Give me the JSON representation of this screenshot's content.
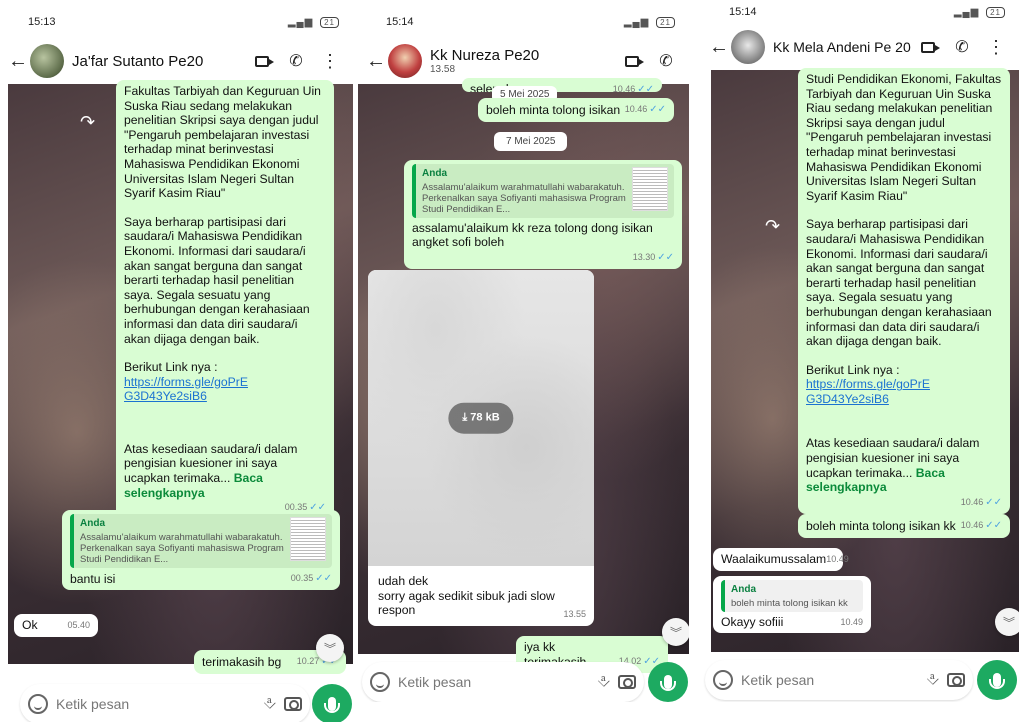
{
  "panels": [
    {
      "time": "15:13",
      "title": "Ja'far Sutanto Pe20",
      "forwarded_text_1": "Fakultas Tarbiyah dan Keguruan Uin Suska Riau sedang melakukan penelitian Skripsi saya dengan judul \"Pengaruh pembelajaran investasi terhadap minat berinvestasi Mahasiswa Pendidikan Ekonomi Universitas Islam Negeri Sultan Syarif Kasim Riau\"",
      "forwarded_text_2": "Saya berharap partisipasi dari saudara/i Mahasiswa Pendidikan Ekonomi. Informasi dari saudara/i akan sangat berguna dan sangat berarti terhadap hasil penelitian saya. Segala sesuatu yang berhubungan dengan kerahasiaan informasi dan data diri saudara/i akan dijaga dengan baik.",
      "link_prefix": "Berikut Link nya :",
      "link": "https://forms.gle/goPrEG3D43Ye2siB6",
      "closing": "Atas kesediaan saudara/i dalam pengisian kuesioner ini saya ucapkan terimaka...",
      "read_more": "Baca selengkapnya",
      "forward_time": "00.35",
      "quote_name": "Anda",
      "quote_body": "Assalamu'alaikum warahmatullahi wabarakatuh. Perkenalkan saya Sofiyanti mahasiswa Program Studi Pendidikan E...",
      "reply_text": "bantu isi",
      "reply_time": "00.35",
      "in_msg": "Ok",
      "in_time": "05.40",
      "out_msg": "terimakasih bg",
      "out_time": "10.27",
      "composer_placeholder": "Ketik pesan"
    },
    {
      "time": "15:14",
      "title": "Kk Nureza Pe20",
      "subtitle": "13.58",
      "top_partial": "selengkapnya",
      "top_partial_time": "10.46",
      "date1": "5 Mei 2025",
      "msg1": "boleh minta tolong isikan",
      "msg1_time": "10.46",
      "date2": "7 Mei 2025",
      "quote_name": "Anda",
      "quote_body": "Assalamu'alaikum warahmatullahi wabarakatuh. Perkenalkan saya Sofiyanti mahasiswa Program Studi Pendidikan E...",
      "msg2": "assalamu'alaikum kk reza tolong dong isikan angket sofi boleh",
      "msg2_time": "13.30",
      "download_size": "78 kB",
      "reply_caption": "udah dek\nsorry agak sedikit sibuk jadi slow respon",
      "reply_time": "13.55",
      "out_msg": "iya kk terimakasih",
      "out_time": "14.02",
      "composer_placeholder": "Ketik pesan"
    },
    {
      "time": "15:14",
      "title": "Kk Mela Andeni Pe 20",
      "forwarded_text_1": "Studi Pendidikan Ekonomi, Fakultas Tarbiyah dan Keguruan Uin Suska Riau sedang melakukan penelitian Skripsi saya dengan judul \"Pengaruh pembelajaran investasi terhadap minat berinvestasi Mahasiswa Pendidikan Ekonomi Universitas Islam Negeri Sultan Syarif Kasim Riau\"",
      "forwarded_text_2": "Saya berharap partisipasi dari saudara/i Mahasiswa Pendidikan Ekonomi. Informasi dari saudara/i akan sangat berguna dan sangat berarti terhadap hasil penelitian saya. Segala sesuatu yang berhubungan dengan kerahasiaan informasi dan data diri saudara/i akan dijaga dengan baik.",
      "link_prefix": "Berikut Link nya :",
      "link": "https://forms.gle/goPrEG3D43Ye2siB6",
      "closing": "Atas kesediaan saudara/i dalam pengisian kuesioner ini saya ucapkan terimaka...",
      "read_more": "Baca selengkapnya",
      "forward_time": "10.46",
      "msg1": "boleh minta tolong isikan kk",
      "msg1_time": "10.46",
      "in_msg1": "Waalaikumussalam",
      "in_msg1_time": "10.49",
      "quote_name": "Anda",
      "quote_body": "boleh minta tolong isikan kk",
      "in_msg2": "Okayy sofiii",
      "in_msg2_time": "10.49",
      "composer_placeholder": "Ketik pesan"
    }
  ],
  "colors": {
    "outgoing_bubble": "#d9fdd3",
    "incoming_bubble": "#ffffff",
    "accent_green": "#1daa61",
    "read_tick": "#4fa3e0"
  }
}
